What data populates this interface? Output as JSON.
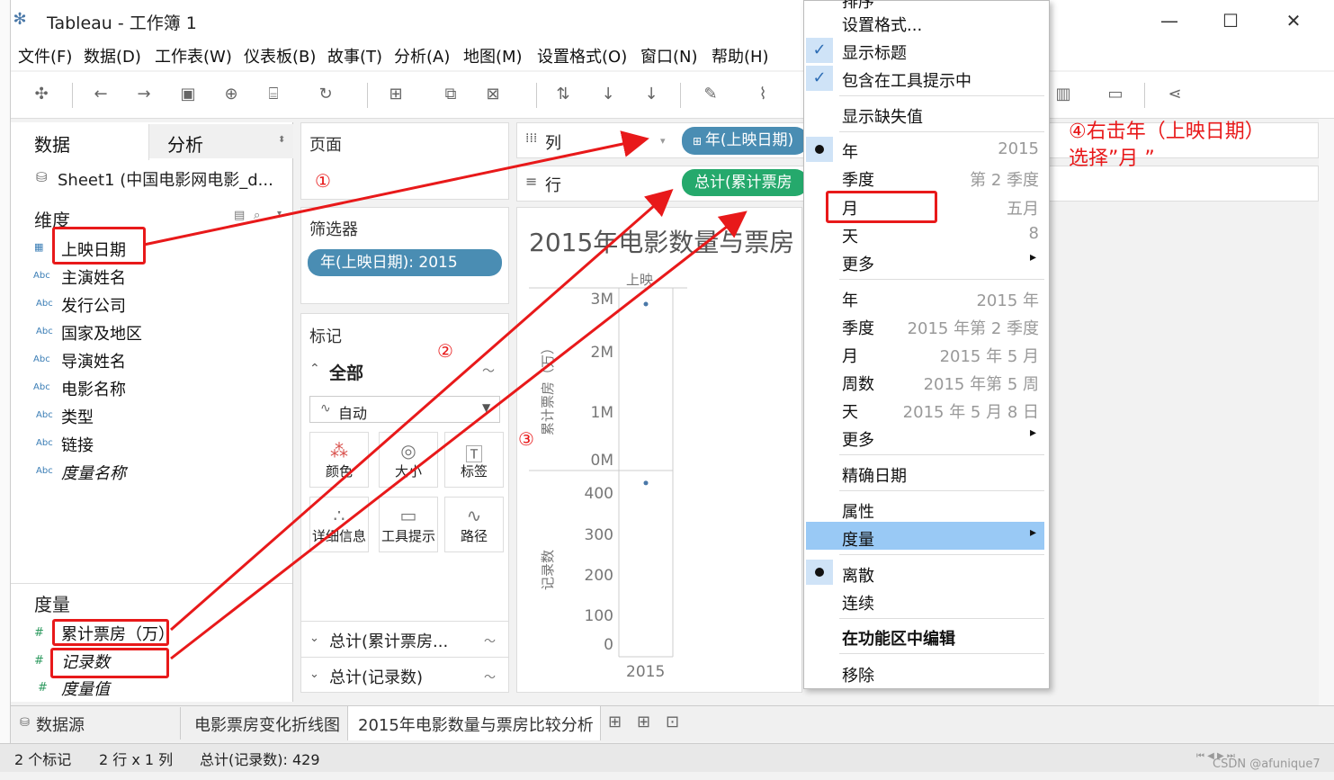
{
  "window": {
    "title": "Tableau - 工作簿 1",
    "controls": [
      "—",
      "☐",
      "✕"
    ]
  },
  "menubar": [
    "文件(F)",
    "数据(D)",
    "工作表(W)",
    "仪表板(B)",
    "故事(T)",
    "分析(A)",
    "地图(M)",
    "设置格式(O)",
    "窗口(N)",
    "帮助(H)"
  ],
  "left_pane": {
    "tabs": {
      "data": "数据",
      "analysis": "分析"
    },
    "datasource": "Sheet1 (中国电影网电影_d...",
    "dimensions_title": "维度",
    "dimensions": [
      {
        "type": "",
        "label": "上映日期",
        "italic": false
      },
      {
        "type": "Abc",
        "label": "主演姓名",
        "italic": false
      },
      {
        "type": "Abc",
        "label": "发行公司",
        "italic": false
      },
      {
        "type": "Abc",
        "label": "国家及地区",
        "italic": false
      },
      {
        "type": "Abc",
        "label": "导演姓名",
        "italic": false
      },
      {
        "type": "Abc",
        "label": "电影名称",
        "italic": false
      },
      {
        "type": "Abc",
        "label": "类型",
        "italic": false
      },
      {
        "type": "Abc",
        "label": "链接",
        "italic": false
      },
      {
        "type": "Abc",
        "label": "度量名称",
        "italic": true
      }
    ],
    "measures_title": "度量",
    "measures": [
      {
        "type": "#",
        "label": "累计票房（万）",
        "italic": false
      },
      {
        "type": "#",
        "label": "记录数",
        "italic": true
      },
      {
        "type": "#",
        "label": "度量值",
        "italic": true
      }
    ]
  },
  "pages_card": {
    "title": "页面"
  },
  "filters_card": {
    "title": "筛选器",
    "pill": "年(上映日期): 2015"
  },
  "marks_card": {
    "title": "标记",
    "all_label": "全部",
    "mark_type": "自动",
    "buttons": [
      {
        "icon": "color-icon",
        "label": "颜色"
      },
      {
        "icon": "size-icon",
        "label": "大小"
      },
      {
        "icon": "label-icon",
        "label": "标签"
      },
      {
        "icon": "detail-icon",
        "label": "详细信息"
      },
      {
        "icon": "tooltip-icon",
        "label": "工具提示"
      },
      {
        "icon": "path-icon",
        "label": "路径"
      }
    ],
    "sections": [
      "总计(累计票房...",
      "总计(记录数)"
    ]
  },
  "shelves": {
    "columns_label": "列",
    "rows_label": "行",
    "columns_pill": "年(上映日期)",
    "rows_pill": "总计(累计票房"
  },
  "view": {
    "title": "2015年电影数量与票房",
    "header": "上映",
    "y1_label": "累计票房（万）",
    "y1_ticks": [
      "3M",
      "2M",
      "1M",
      "0M"
    ],
    "y2_label": "记录数",
    "y2_ticks": [
      "400",
      "300",
      "200",
      "100",
      "0"
    ],
    "x_tick": "2015"
  },
  "chart_data": [
    {
      "type": "scatter",
      "x": [
        "2015"
      ],
      "series": [
        {
          "values": [
            2900000
          ]
        }
      ],
      "ylabel": "累计票房（万）",
      "yticks": [
        "0M",
        "1M",
        "2M",
        "3M"
      ]
    },
    {
      "type": "scatter",
      "x": [
        "2015"
      ],
      "series": [
        {
          "values": [
            429
          ]
        }
      ],
      "ylabel": "记录数",
      "yticks": [
        "0",
        "100",
        "200",
        "300",
        "400"
      ]
    }
  ],
  "context_menu": {
    "items": [
      {
        "label": "设置格式...",
        "right": "",
        "state": "none",
        "bold": false
      },
      {
        "label": "显示标题",
        "right": "",
        "state": "check",
        "bold": false
      },
      {
        "label": "包含在工具提示中",
        "right": "",
        "state": "check",
        "bold": false
      },
      {
        "label": "显示缺失值",
        "right": "",
        "state": "none",
        "bold": false
      },
      {
        "label": "年",
        "right": "2015",
        "state": "dot",
        "bold": false
      },
      {
        "label": "季度",
        "right": "第 2 季度",
        "state": "none",
        "bold": false
      },
      {
        "label": "月",
        "right": "五月",
        "state": "none",
        "bold": false
      },
      {
        "label": "天",
        "right": "8",
        "state": "none",
        "bold": false
      },
      {
        "label": "更多",
        "right": "▸",
        "state": "none",
        "bold": false
      },
      {
        "label": "年",
        "right": "2015 年",
        "state": "none",
        "bold": false
      },
      {
        "label": "季度",
        "right": "2015 年第 2 季度",
        "state": "none",
        "bold": false
      },
      {
        "label": "月",
        "right": "2015 年 5 月",
        "state": "none",
        "bold": false
      },
      {
        "label": "周数",
        "right": "2015 年第 5 周",
        "state": "none",
        "bold": false
      },
      {
        "label": "天",
        "right": "2015 年 5 月 8 日",
        "state": "none",
        "bold": false
      },
      {
        "label": "更多",
        "right": "▸",
        "state": "none",
        "bold": false
      },
      {
        "label": "精确日期",
        "right": "",
        "state": "none",
        "bold": false
      },
      {
        "label": "属性",
        "right": "",
        "state": "none",
        "bold": false
      },
      {
        "label": "度量",
        "right": "▸",
        "state": "highlight",
        "bold": false
      },
      {
        "label": "离散",
        "right": "",
        "state": "dot",
        "bold": false
      },
      {
        "label": "连续",
        "right": "",
        "state": "none",
        "bold": false
      },
      {
        "label": "在功能区中编辑",
        "right": "",
        "state": "none",
        "bold": true
      },
      {
        "label": "移除",
        "right": "",
        "state": "none",
        "bold": false
      }
    ],
    "top_partial": "排序"
  },
  "annotations": {
    "n1": "①",
    "n2": "②",
    "n3": "③",
    "n4_line1": "④右击年（上映日期）",
    "n4_line2": "选择”月 ”"
  },
  "sheet_tabs": {
    "datasource": "数据源",
    "sheets": [
      "电影票房变化折线图",
      "2015年电影数量与票房比较分析"
    ]
  },
  "status": {
    "marks": "2 个标记",
    "dims": "2 行 x 1 列",
    "sum": "总计(记录数): 429",
    "watermark": "CSDN @afunique7"
  },
  "colors": {
    "pill_blue": "#4a8db3",
    "pill_green": "#25a96c",
    "annotation_red": "#e8191a",
    "menu_highlight": "#99c9f5"
  }
}
